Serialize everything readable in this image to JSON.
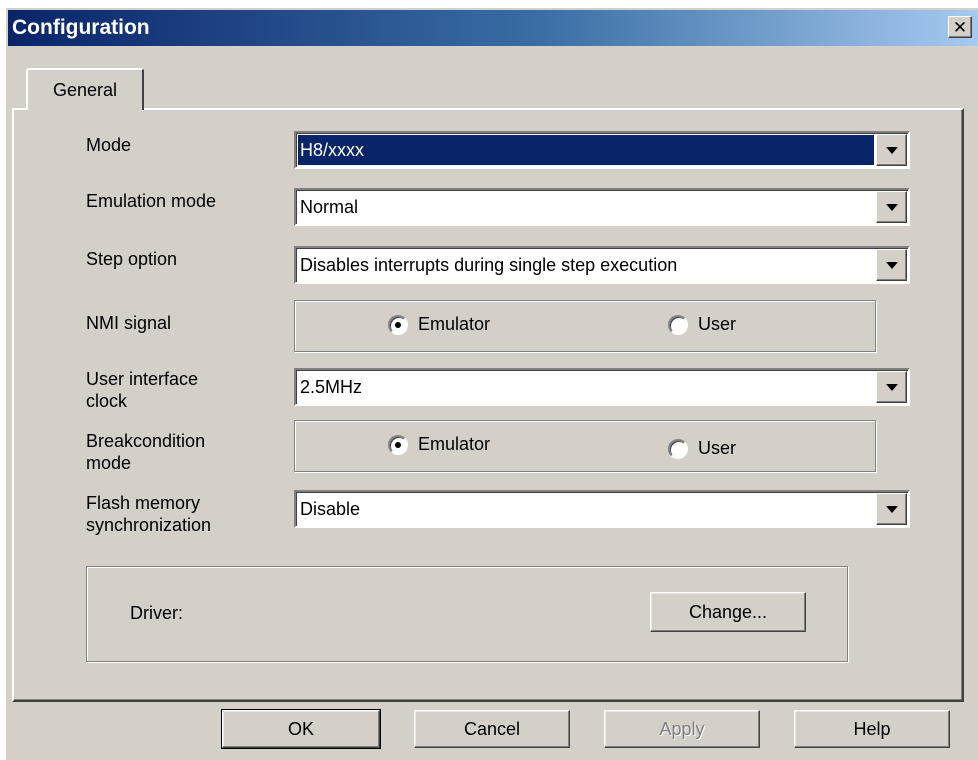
{
  "window": {
    "title": "Configuration",
    "close_label": "✕"
  },
  "tabs": [
    {
      "label": "General"
    }
  ],
  "fields": {
    "mode": {
      "label": "Mode",
      "value": "H8/xxxx"
    },
    "emulation_mode": {
      "label": "Emulation mode",
      "value": "Normal"
    },
    "step_option": {
      "label": "Step option",
      "value": "Disables interrupts during single step execution"
    },
    "nmi_signal": {
      "label": "NMI signal",
      "options": [
        "Emulator",
        "User"
      ],
      "selected": "Emulator"
    },
    "user_interface_clock": {
      "label_line1": "User interface",
      "label_line2": "clock",
      "value": "2.5MHz"
    },
    "breakcondition_mode": {
      "label_line1": "Breakcondition",
      "label_line2": "mode",
      "options": [
        "Emulator",
        "User"
      ],
      "selected": "Emulator"
    },
    "flash_memory_sync": {
      "label_line1": "Flash memory",
      "label_line2": "synchronization",
      "value": "Disable"
    }
  },
  "driver": {
    "label": "Driver:",
    "change_button": "Change..."
  },
  "buttons": {
    "ok": "OK",
    "cancel": "Cancel",
    "apply": "Apply",
    "help": "Help"
  },
  "colors": {
    "title_start": "#0a246a",
    "title_end": "#a6caf0",
    "face": "#d4d0c8",
    "selection": "#0a246a"
  }
}
